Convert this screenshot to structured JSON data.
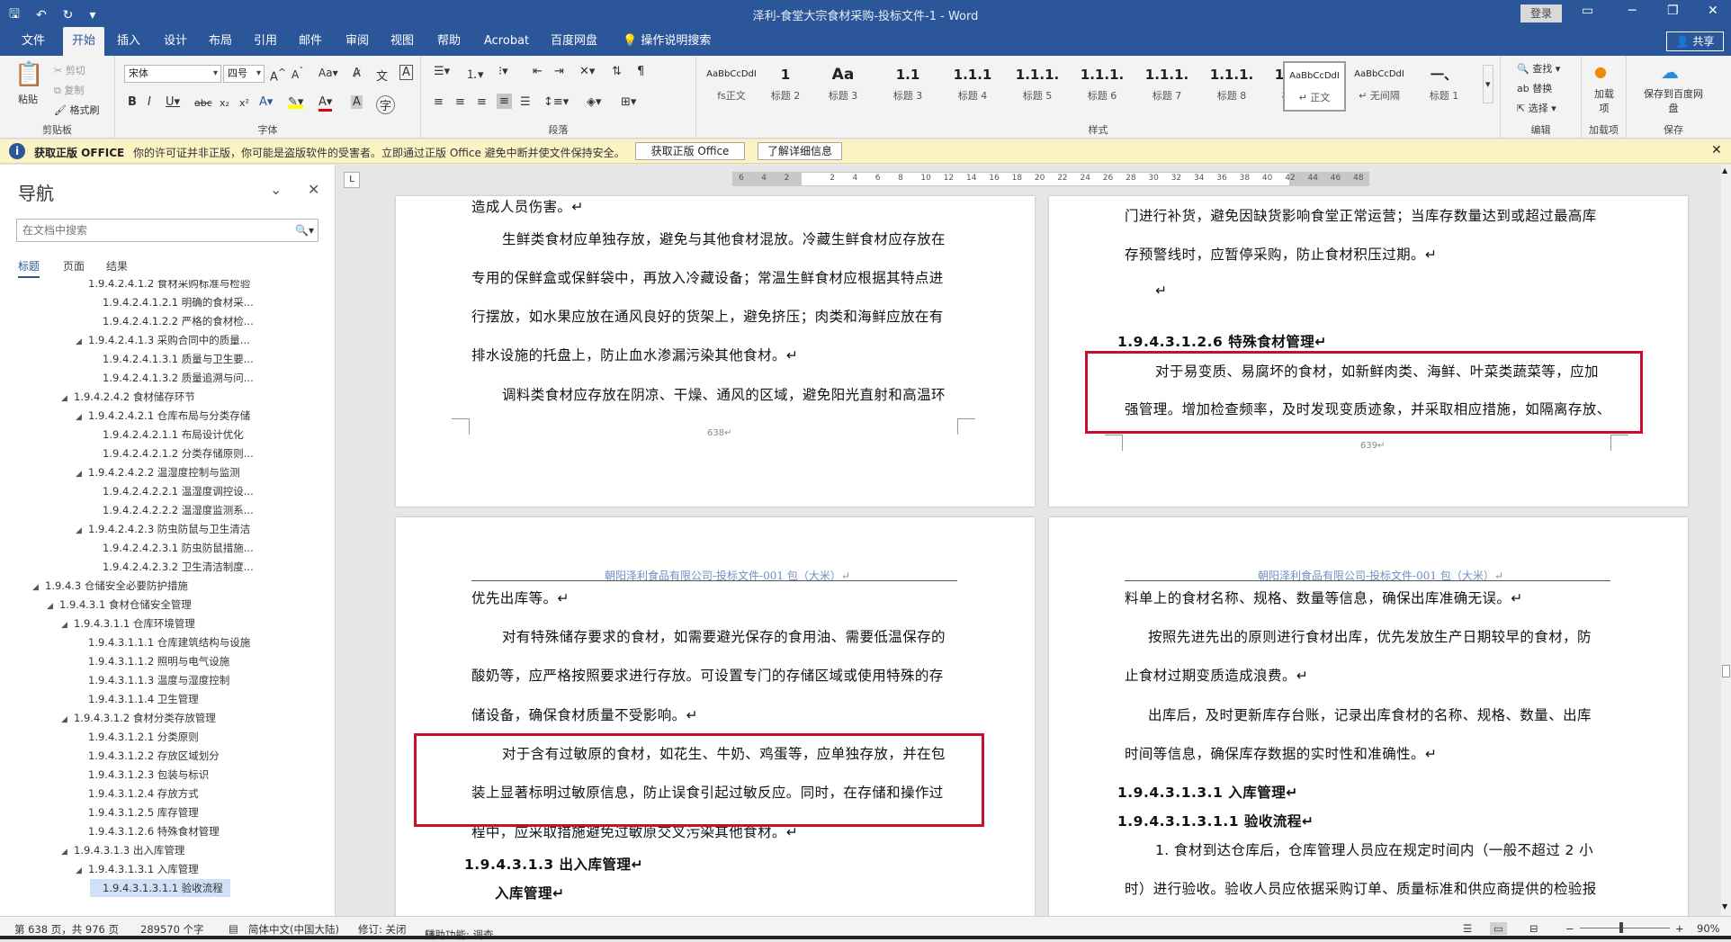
{
  "window": {
    "title": "泽利-食堂大宗食材采购-投标文件-1  -  Word",
    "login": "登录"
  },
  "tabs": [
    "文件",
    "开始",
    "插入",
    "设计",
    "布局",
    "引用",
    "邮件",
    "审阅",
    "视图",
    "帮助",
    "Acrobat",
    "百度网盘",
    "操作说明搜索"
  ],
  "share": "共享",
  "ribbon": {
    "clipboard": {
      "paste": "粘贴",
      "cut": "剪切",
      "copy": "复制",
      "format_painter": "格式刷",
      "label": "剪贴板"
    },
    "font": {
      "name": "宋体",
      "size": "四号",
      "label": "字体"
    },
    "paragraph": {
      "label": "段落"
    },
    "styles": {
      "label": "样式",
      "items": [
        {
          "preview": "AaBbCcDdI",
          "name": "fs正文"
        },
        {
          "preview": "1",
          "name": "标题 2"
        },
        {
          "preview": "Aa",
          "name": "标题 3"
        },
        {
          "preview": "1.1",
          "name": "标题 3"
        },
        {
          "preview": "1.1.1",
          "name": "标题 4"
        },
        {
          "preview": "1.1.1.",
          "name": "标题 5"
        },
        {
          "preview": "1.1.1.",
          "name": "标题 6"
        },
        {
          "preview": "1.1.1.",
          "name": "标题 7"
        },
        {
          "preview": "1.1.1.",
          "name": "标题 8"
        },
        {
          "preview": "1.1.1.",
          "name": "标题 9"
        },
        {
          "preview": "AaBbCcDdI",
          "name": "↵ 正文"
        },
        {
          "preview": "AaBbCcDdI",
          "name": "↵ 无间隔"
        },
        {
          "preview": "一、",
          "name": "标题 1"
        }
      ]
    },
    "editing": {
      "find": "查找",
      "replace": "替换",
      "select": "选择",
      "label": "编辑"
    },
    "addins": {
      "btn": "加载项",
      "label": "加载项"
    },
    "save": {
      "btn": "保存到百度网盘",
      "label": "保存"
    }
  },
  "message_bar": {
    "title": "获取正版 OFFICE",
    "text": "你的许可证并非正版，你可能是盗版软件的受害者。立即通过正版 Office 避免中断并使文件保持安全。",
    "btn1": "获取正版 Office",
    "btn2": "了解详细信息"
  },
  "nav": {
    "title": "导航",
    "search_placeholder": "在文档中搜索",
    "tabs": [
      "标题",
      "页面",
      "结果"
    ],
    "tree": [
      {
        "t": "1.9.4.2.4.1.2 食材采购标准与检验",
        "lv": 6,
        "ar": ""
      },
      {
        "t": "1.9.4.2.4.1.2.1 明确的食材采...",
        "lv": 7,
        "ar": ""
      },
      {
        "t": "1.9.4.2.4.1.2.2 严格的食材检...",
        "lv": 7,
        "ar": ""
      },
      {
        "t": "1.9.4.2.4.1.3 采购合同中的质量...",
        "lv": 6,
        "ar": "◢"
      },
      {
        "t": "1.9.4.2.4.1.3.1 质量与卫生要...",
        "lv": 7,
        "ar": ""
      },
      {
        "t": "1.9.4.2.4.1.3.2 质量追溯与问...",
        "lv": 7,
        "ar": ""
      },
      {
        "t": "1.9.4.2.4.2 食材储存环节",
        "lv": 5,
        "ar": "◢"
      },
      {
        "t": "1.9.4.2.4.2.1 仓库布局与分类存储",
        "lv": 6,
        "ar": "◢"
      },
      {
        "t": "1.9.4.2.4.2.1.1 布局设计优化",
        "lv": 7,
        "ar": ""
      },
      {
        "t": "1.9.4.2.4.2.1.2 分类存储原则...",
        "lv": 7,
        "ar": ""
      },
      {
        "t": "1.9.4.2.4.2.2 温湿度控制与监测",
        "lv": 6,
        "ar": "◢"
      },
      {
        "t": "1.9.4.2.4.2.2.1 温湿度调控设...",
        "lv": 7,
        "ar": ""
      },
      {
        "t": "1.9.4.2.4.2.2.2 温湿度监测系...",
        "lv": 7,
        "ar": ""
      },
      {
        "t": "1.9.4.2.4.2.3 防虫防鼠与卫生清洁",
        "lv": 6,
        "ar": "◢"
      },
      {
        "t": "1.9.4.2.4.2.3.1 防虫防鼠措施...",
        "lv": 7,
        "ar": ""
      },
      {
        "t": "1.9.4.2.4.2.3.2 卫生清洁制度...",
        "lv": 7,
        "ar": ""
      },
      {
        "t": "1.9.4.3 仓储安全必要防护措施",
        "lv": 3,
        "ar": "◢"
      },
      {
        "t": "1.9.4.3.1 食材仓储安全管理",
        "lv": 4,
        "ar": "◢"
      },
      {
        "t": "1.9.4.3.1.1 仓库环境管理",
        "lv": 5,
        "ar": "◢"
      },
      {
        "t": "1.9.4.3.1.1.1 仓库建筑结构与设施",
        "lv": 6,
        "ar": ""
      },
      {
        "t": "1.9.4.3.1.1.2 照明与电气设施",
        "lv": 6,
        "ar": ""
      },
      {
        "t": "1.9.4.3.1.1.3 温度与湿度控制",
        "lv": 6,
        "ar": ""
      },
      {
        "t": "1.9.4.3.1.1.4 卫生管理",
        "lv": 6,
        "ar": ""
      },
      {
        "t": "1.9.4.3.1.2 食材分类存放管理",
        "lv": 5,
        "ar": "◢"
      },
      {
        "t": "1.9.4.3.1.2.1 分类原则",
        "lv": 6,
        "ar": ""
      },
      {
        "t": "1.9.4.3.1.2.2 存放区域划分",
        "lv": 6,
        "ar": ""
      },
      {
        "t": "1.9.4.3.1.2.3 包装与标识",
        "lv": 6,
        "ar": ""
      },
      {
        "t": "1.9.4.3.1.2.4 存放方式",
        "lv": 6,
        "ar": ""
      },
      {
        "t": "1.9.4.3.1.2.5 库存管理",
        "lv": 6,
        "ar": ""
      },
      {
        "t": "1.9.4.3.1.2.6 特殊食材管理",
        "lv": 6,
        "ar": ""
      },
      {
        "t": "1.9.4.3.1.3 出入库管理",
        "lv": 5,
        "ar": "◢"
      },
      {
        "t": "1.9.4.3.1.3.1 入库管理",
        "lv": 6,
        "ar": "◢"
      },
      {
        "t": "1.9.4.3.1.3.1.1 验收流程",
        "lv": 7,
        "ar": "",
        "sel": true
      }
    ]
  },
  "ruler_labels": [
    "6",
    "4",
    "2",
    "",
    "2",
    "4",
    "6",
    "8",
    "10",
    "12",
    "14",
    "16",
    "18",
    "20",
    "22",
    "24",
    "26",
    "28",
    "30",
    "32",
    "34",
    "36",
    "38",
    "40",
    "42",
    "44",
    "46",
    "48"
  ],
  "pages": {
    "p638": {
      "lines": [
        "造成人员伤害。↵",
        "生鲜类食材应单独存放，避免与其他食材混放。冷藏生鲜食材应存放在",
        "专用的保鲜盒或保鲜袋中，再放入冷藏设备；常温生鲜食材应根据其特点进",
        "行摆放，如水果应放在通风良好的货架上，避免挤压；肉类和海鲜应放在有",
        "排水设施的托盘上，防止血水渗漏污染其他食材。↵",
        "调料类食材应存放在阴凉、干燥、通风的区域，避免阳光直射和高温环"
      ],
      "page_num": "638↵"
    },
    "p639": {
      "lines": [
        "门进行补货，避免因缺货影响食堂正常运营；当库存数量达到或超过最高库",
        "存预警线时，应暂停采购，防止食材积压过期。↵",
        "↵"
      ],
      "heading": "1.9.4.3.1.2.6  特殊食材管理↵",
      "box_lines": [
        "对于易变质、易腐坏的食材，如新鲜肉类、海鲜、叶菜类蔬菜等，应加",
        "强管理。增加检查频率，及时发现变质迹象，并采取相应措施，如隔离存放、"
      ],
      "page_num": "639↵"
    },
    "p640": {
      "header": "朝阳泽利食品有限公司-投标文件-001 包（大米）↵",
      "lines": [
        "优先出库等。↵",
        "对有特殊储存要求的食材，如需要避光保存的食用油、需要低温保存的",
        "酸奶等，应严格按照要求进行存放。可设置专门的存储区域或使用特殊的存",
        "储设备，确保食材质量不受影响。↵"
      ],
      "box_lines": [
        "对于含有过敏原的食材，如花生、牛奶、鸡蛋等，应单独存放，并在包",
        "装上显著标明过敏原信息，防止误食引起过敏反应。同时，在存储和操作过",
        "程中，应采取措施避免过敏原交叉污染其他食材。↵"
      ],
      "h1": "1.9.4.3.1.3 出入库管理↵",
      "h2": "入库管理↵"
    },
    "p641": {
      "header": "朝阳泽利食品有限公司-投标文件-001 包（大米）↵",
      "lines": [
        "料单上的食材名称、规格、数量等信息，确保出库准确无误。↵",
        "按照先进先出的原则进行食材出库，优先发放生产日期较早的食材，防",
        "止食材过期变质造成浪费。↵",
        "出库后，及时更新库存台账，记录出库食材的名称、规格、数量、出库",
        "时间等信息，确保库存数据的实时性和准确性。↵"
      ],
      "h1": "1.9.4.3.1.3.1  入库管理↵",
      "h2": "1.9.4.3.1.3.1.1   验收流程↵",
      "tail": [
        "1. 食材到达仓库后，仓库管理人员应在规定时间内（一般不超过 2 小",
        "时）进行验收。验收人员应依据采购订单、质量标准和供应商提供的检验报"
      ]
    }
  },
  "status": {
    "page": "第 638 页，共 976 页",
    "words": "289570 个字",
    "lang": "简体中文(中国大陆)",
    "track": "修订: 关闭",
    "access": "辅助功能: 调查",
    "zoom": "90%"
  }
}
